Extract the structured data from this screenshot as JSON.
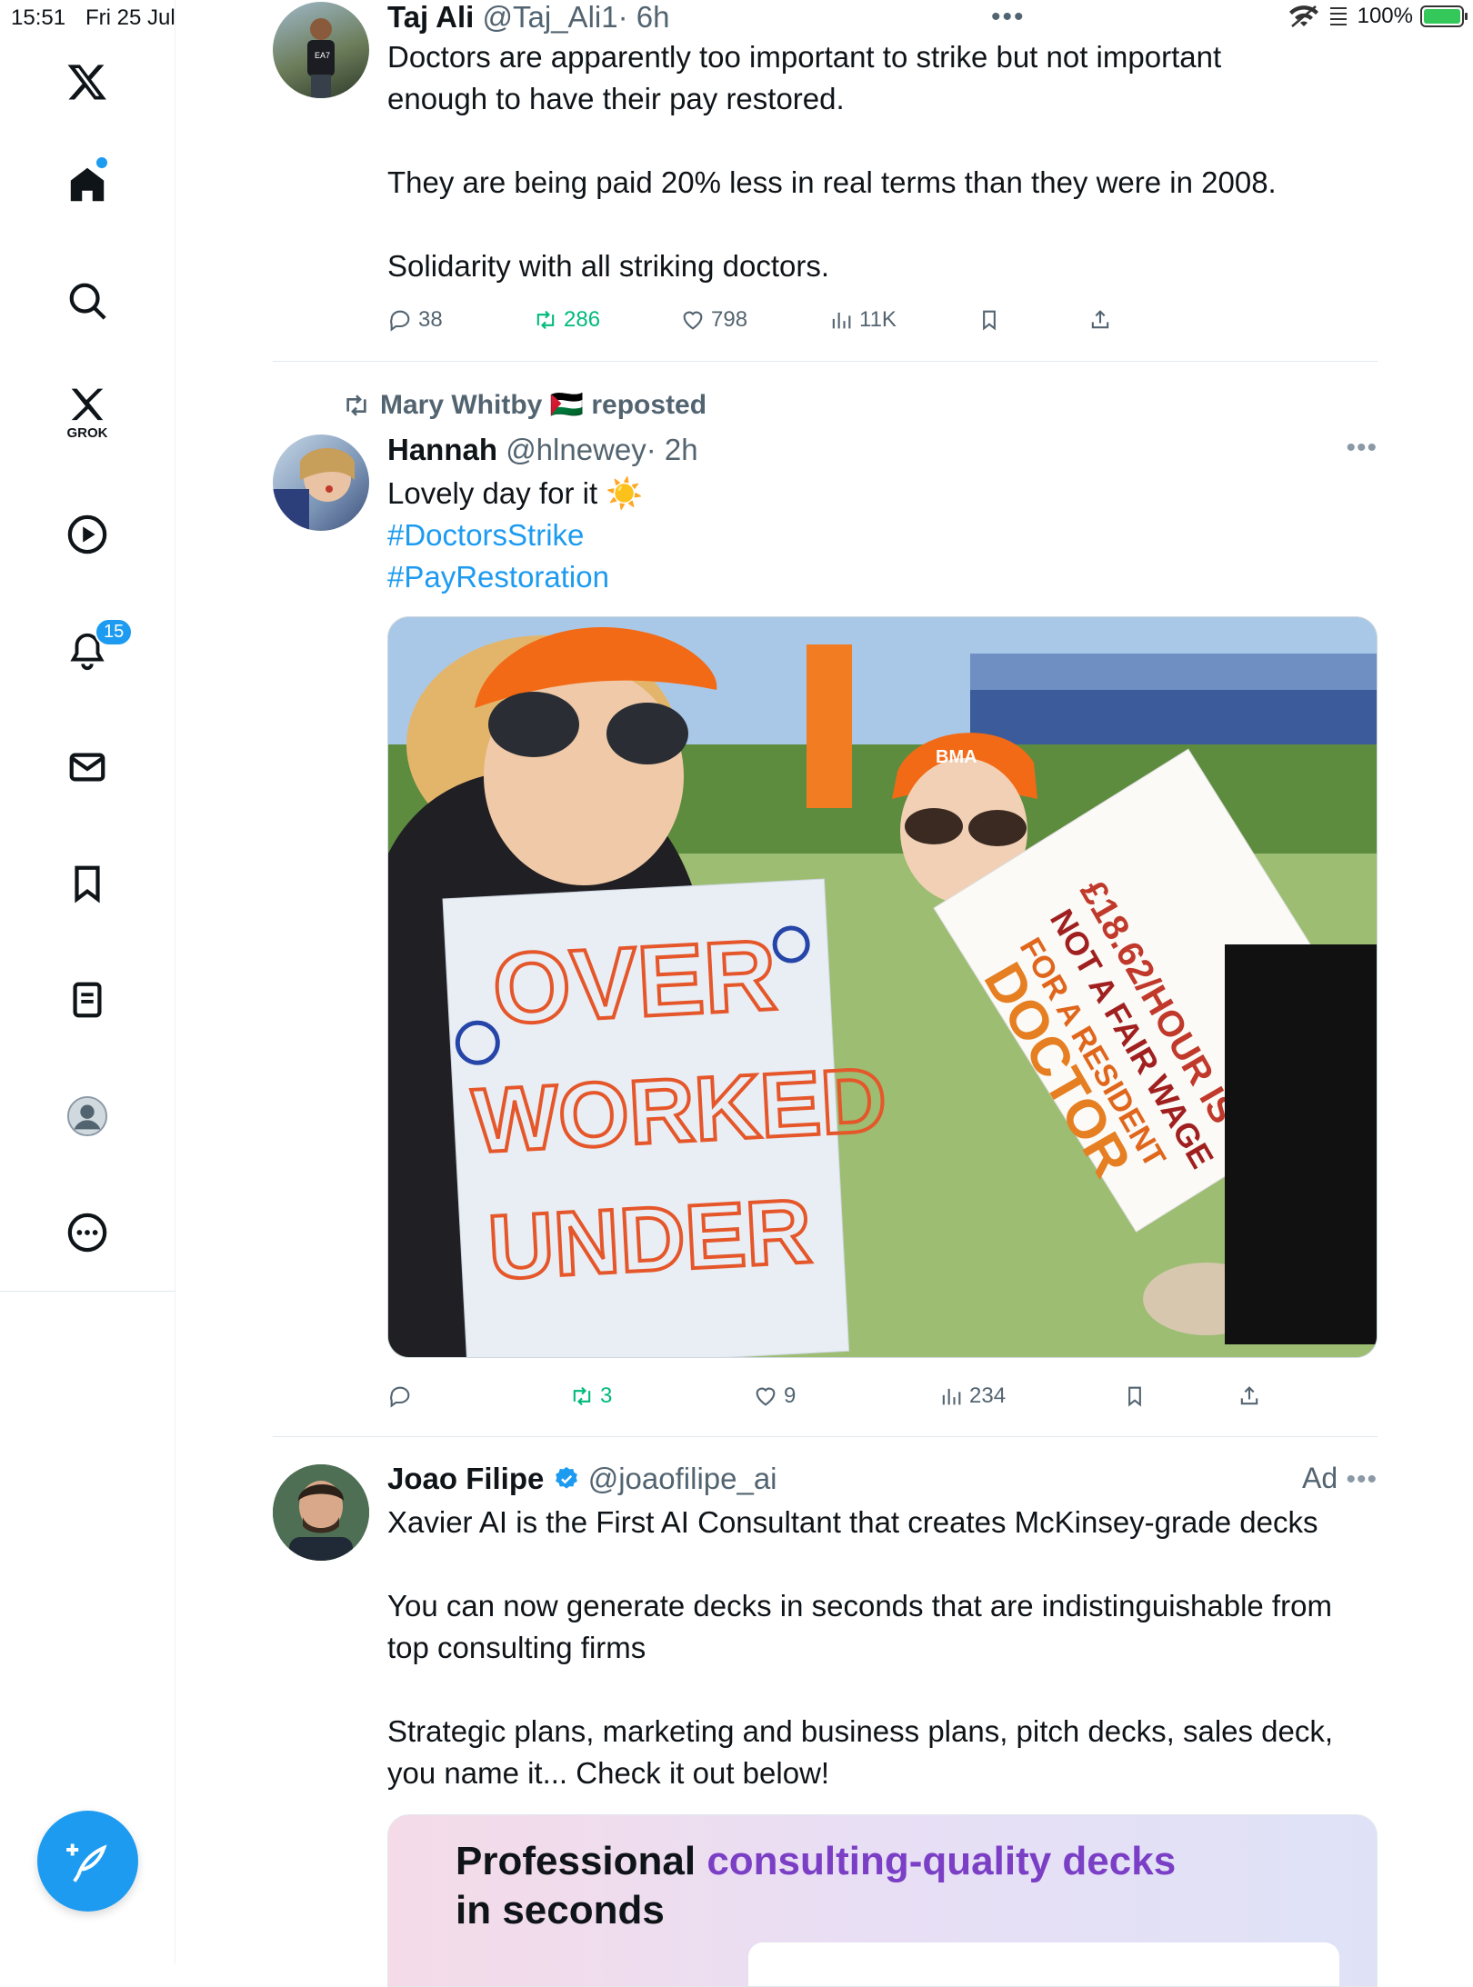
{
  "status": {
    "time": "15:51",
    "date": "Fri 25 Jul",
    "battery": "100%"
  },
  "sidebar": {
    "notification_count": "15",
    "grok_label": "GROK"
  },
  "tweets": [
    {
      "name": "Taj Ali",
      "handle": "@Taj_Ali1",
      "time": "· 6h",
      "lines": [
        "Doctors are apparently too important to strike but not important",
        "enough to have their pay restored.",
        "They are being paid 20% less in real terms than they were in 2008.",
        "Solidarity with all striking doctors."
      ],
      "stats": {
        "replies": "38",
        "reposts": "286",
        "likes": "798",
        "views": "11K"
      }
    },
    {
      "repost_by": "Mary Whitby 🇵🇸 reposted",
      "name": "Hannah",
      "handle": "@hlnewey",
      "time": "· 2h",
      "text": "Lovely day for it ☀️",
      "hashtags": [
        "#DoctorsStrike",
        "#PayRestoration"
      ],
      "media": {
        "sign_left": [
          "OVER",
          "WORKED",
          "UNDER"
        ],
        "sign_right": [
          "£18.62/HOUR IS",
          "NOT A FAIR WAGE",
          "FOR A RESIDENT",
          "DOCTOR"
        ],
        "cap_text": "BMA"
      },
      "stats": {
        "replies": "",
        "reposts": "3",
        "likes": "9",
        "views": "234"
      }
    },
    {
      "name": "Joao Filipe",
      "handle": "@joaofilipe_ai",
      "ad_label": "Ad",
      "lines": [
        "Xavier AI is the First AI Consultant that creates McKinsey-grade decks",
        "You can now generate decks in seconds that are indistinguishable from",
        "top consulting firms",
        "Strategic plans, marketing and business plans, pitch decks, sales deck,",
        "you name it... Check it out below!"
      ],
      "card": {
        "title_a": "Professional ",
        "title_b": "consulting-quality decks",
        "title_c": "in seconds"
      }
    }
  ],
  "colors": {
    "accent": "#1d9bf0",
    "repost": "#00ba7c",
    "muted": "#536471"
  }
}
